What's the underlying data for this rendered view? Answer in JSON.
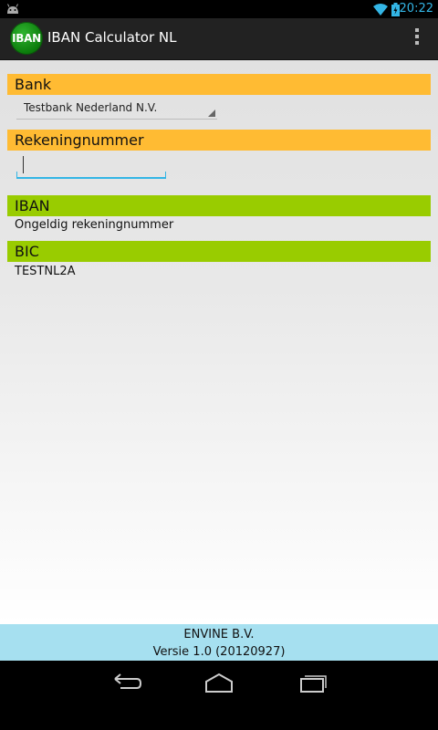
{
  "status_bar": {
    "time": "20:22",
    "icons": [
      "android-icon",
      "wifi-icon",
      "battery-charging-icon"
    ]
  },
  "action_bar": {
    "icon_text": "IBAN",
    "title": "IBAN Calculator NL",
    "overflow_icon": "overflow-menu-icon"
  },
  "bank": {
    "header": "Bank",
    "selected": "Testbank Nederland N.V."
  },
  "account": {
    "header": "Rekeningnummer",
    "value": ""
  },
  "iban": {
    "header": "IBAN",
    "value": "Ongeldig rekeningnummer"
  },
  "bic": {
    "header": "BIC",
    "value": "TESTNL2A"
  },
  "footer": {
    "company": "ENVINE B.V.",
    "version": "Versie 1.0 (20120927)"
  },
  "nav": {
    "icons": [
      "back-icon",
      "home-icon",
      "recents-icon"
    ]
  },
  "colors": {
    "section_orange": "#ffbb33",
    "section_green": "#99cc00",
    "footer_blue": "#a6e0f0",
    "accent": "#33b5e5"
  }
}
